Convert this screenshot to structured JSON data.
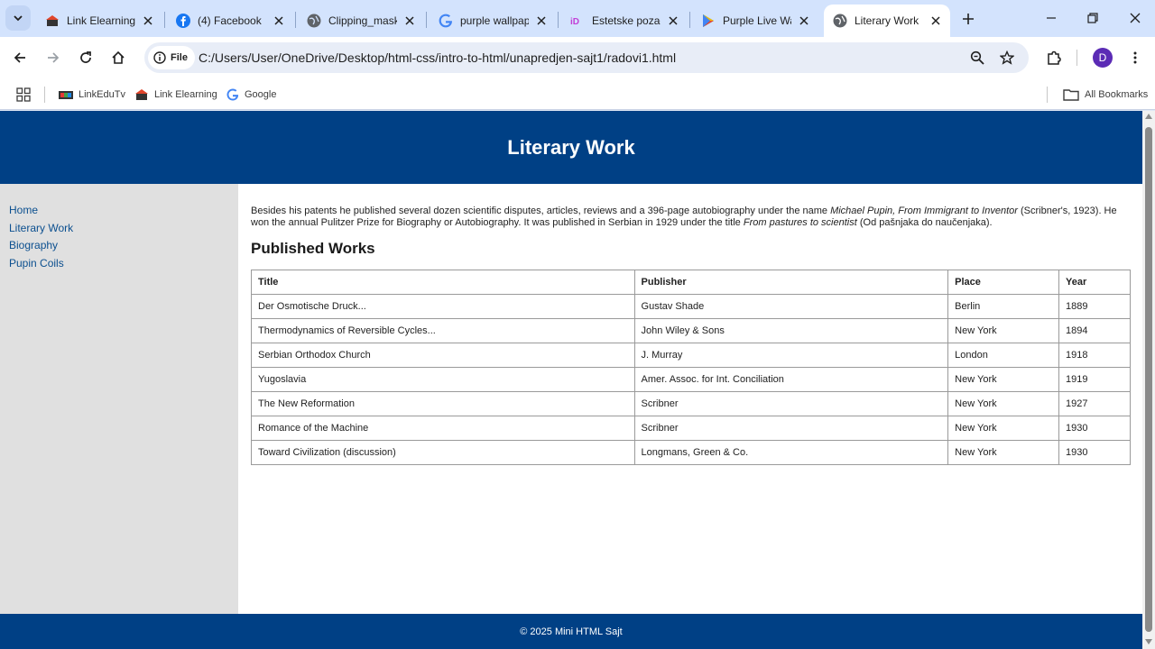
{
  "browser": {
    "tabs": [
      {
        "label": "Link Elearning",
        "icon": "elearning-favicon"
      },
      {
        "label": "(4) Facebook",
        "icon": "facebook-favicon"
      },
      {
        "label": "Clipping_mask",
        "icon": "globe-favicon"
      },
      {
        "label": "purple wallpaper",
        "icon": "google-favicon"
      },
      {
        "label": "Estetske pozadine",
        "icon": "estetske-favicon"
      },
      {
        "label": "Purple Live Wallpaper",
        "icon": "play-store-favicon"
      },
      {
        "label": "Literary Work",
        "icon": "globe-favicon",
        "active": true
      }
    ],
    "site_chip": "File",
    "url": "C:/Users/User/OneDrive/Desktop/html-css/intro-to-html/unapredjen-sajt1/radovi1.html",
    "profile_initial": "D",
    "bookmarks": [
      {
        "label": "LinkEduTv",
        "icon": "linkedutv-favicon"
      },
      {
        "label": "Link Elearning",
        "icon": "elearning-favicon"
      },
      {
        "label": "Google",
        "icon": "google-favicon"
      }
    ],
    "all_bookmarks": "All Bookmarks"
  },
  "page": {
    "title": "Literary Work",
    "sidebar": [
      "Home",
      "Literary Work",
      "Biography",
      "Pupin Coils"
    ],
    "intro": {
      "part1": "Besides his patents he published several dozen scientific disputes, articles, reviews and a 396-page autobiography under the name ",
      "italic1": "Michael Pupin, From Immigrant to Inventor",
      "part2": " (Scribner's, 1923). He won the annual Pulitzer Prize for Biography or Autobiography. It was published in Serbian in 1929 under the title ",
      "italic2": "From pastures to scientist",
      "part3": " (Od pašnjaka do naučenjaka)."
    },
    "works_heading": "Published Works",
    "table": {
      "headers": [
        "Title",
        "Publisher",
        "Place",
        "Year"
      ],
      "rows": [
        [
          "Der Osmotische Druck...",
          "Gustav Shade",
          "Berlin",
          "1889"
        ],
        [
          "Thermodynamics of Reversible Cycles...",
          "John Wiley & Sons",
          "New York",
          "1894"
        ],
        [
          "Serbian Orthodox Church",
          "J. Murray",
          "London",
          "1918"
        ],
        [
          "Yugoslavia",
          "Amer. Assoc. for Int. Conciliation",
          "New York",
          "1919"
        ],
        [
          "The New Reformation",
          "Scribner",
          "New York",
          "1927"
        ],
        [
          "Romance of the Machine",
          "Scribner",
          "New York",
          "1930"
        ],
        [
          "Toward Civilization (discussion)",
          "Longmans, Green & Co.",
          "New York",
          "1930"
        ]
      ]
    },
    "footer": "© 2025 Mini HTML Sajt"
  },
  "colors": {
    "header_bg": "#004085",
    "sidebar_bg": "#e0e0e0",
    "link": "#0b4f8f",
    "tabstrip_bg": "#d3e3fd"
  }
}
